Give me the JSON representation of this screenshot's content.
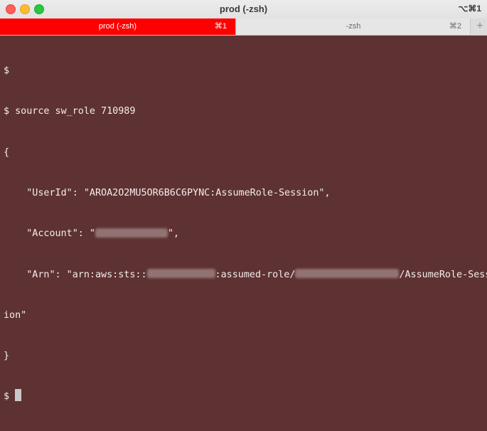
{
  "window": {
    "title": "prod (-zsh)",
    "title_shortcut": "⌥⌘1",
    "accent_color": "#ff0000",
    "terminal_bg": "#5e3232"
  },
  "tabs": [
    {
      "label": "prod (-zsh)",
      "shortcut": "⌘1",
      "active": true
    },
    {
      "label": "-zsh",
      "shortcut": "⌘2",
      "active": false
    }
  ],
  "new_tab_icon": "plus-icon",
  "terminal": {
    "prompt": "$",
    "line1": "$",
    "line2": "$ source sw_role 710989",
    "line3": "{",
    "userid_line": "    \"UserId\": \"AROA2O2MU5OR6B6C6PYNC:AssumeRole-Session\",",
    "account_prefix": "    \"Account\": \"",
    "account_suffix": "\",",
    "arn_prefix": "    \"Arn\": \"arn:aws:sts::",
    "arn_middle": ":assumed-role/",
    "arn_suffix": "/AssumeRole-Sess",
    "arn_wrap": "ion\"",
    "line_close": "}",
    "last_prompt": "$ "
  }
}
